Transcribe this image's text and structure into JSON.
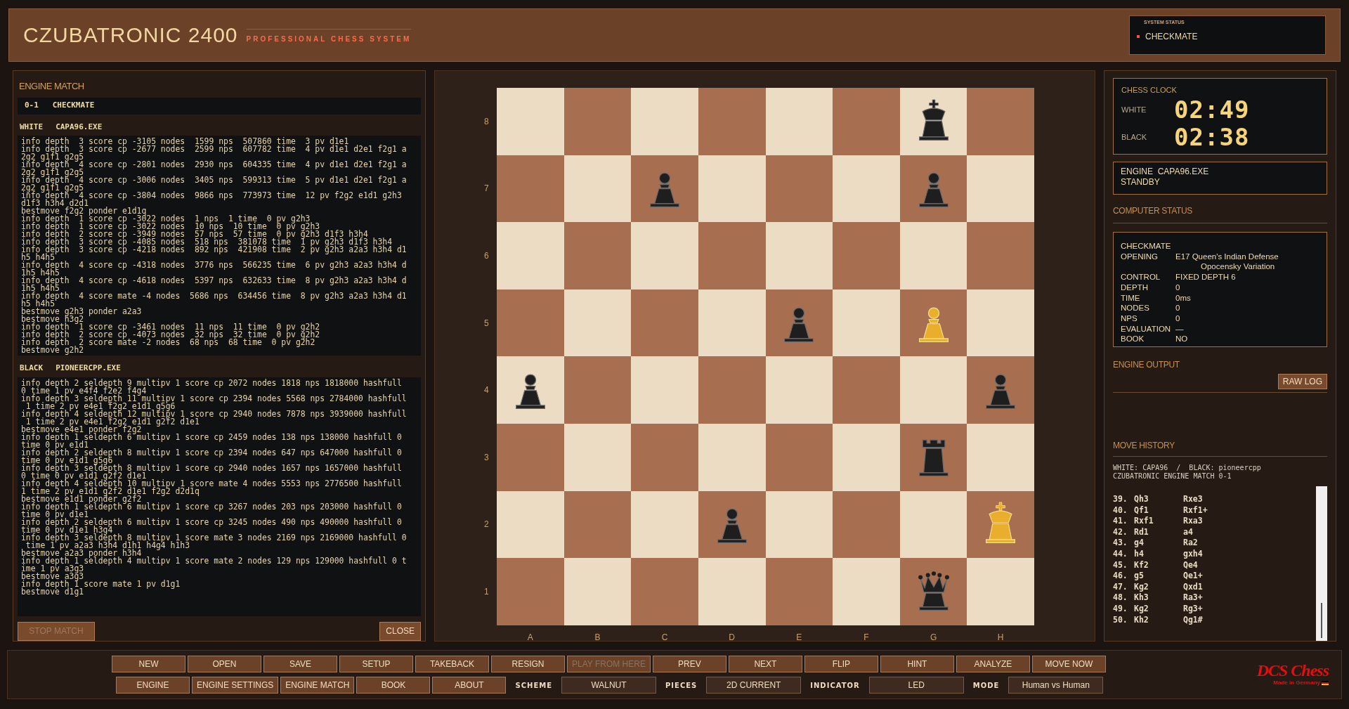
{
  "header": {
    "title": "CZUBATRONIC 2400",
    "subtitle": "PROFESSIONAL CHESS SYSTEM",
    "status_label": "SYSTEM STATUS",
    "status": "CHECKMATE"
  },
  "engine_match": {
    "title": "ENGINE MATCH",
    "result": "0-1   CHECKMATE",
    "white": {
      "label": "WHITE",
      "engine": "CAPA96.EXE",
      "log": [
        "info depth  3 score cp -3105 nodes  1599 nps  507860 time  3 pv d1e1",
        "info depth  3 score cp -2677 nodes  2599 nps  607782 time  4 pv d1e1 d2e1 f2g1 a",
        "2g2 g1f1 g2g5",
        "info depth  4 score cp -2801 nodes  2930 nps  604335 time  4 pv d1e1 d2e1 f2g1 a",
        "2g2 g1f1 g2g5",
        "info depth  4 score cp -3006 nodes  3405 nps  599313 time  5 pv d1e1 d2e1 f2g1 a",
        "2g2 g1f1 g2g5",
        "info depth  4 score cp -3804 nodes  9866 nps  773973 time  12 pv f2g2 e1d1 g2h3",
        "d1f3 h3h4 d2d1",
        "bestmove f2g2 ponder e1d1q",
        "info depth  1 score cp -3022 nodes  1 nps  1 time  0 pv g2h3",
        "info depth  1 score cp -3022 nodes  10 nps  10 time  0 pv g2h3",
        "info depth  2 score cp -3949 nodes  57 nps  57 time  0 pv g2h3 d1f3 h3h4",
        "info depth  3 score cp -4085 nodes  518 nps  381078 time  1 pv g2h3 d1f3 h3h4",
        "info depth  3 score cp -4218 nodes  892 nps  421908 time  2 pv g2h3 a2a3 h3h4 d1",
        "h5 h4h5",
        "info depth  4 score cp -4318 nodes  3776 nps  566235 time  6 pv g2h3 a2a3 h3h4 d",
        "1h5 h4h5",
        "info depth  4 score cp -4618 nodes  5397 nps  632633 time  8 pv g2h3 a2a3 h3h4 d",
        "1h5 h4h5",
        "info depth  4 score mate -4 nodes  5686 nps  634456 time  8 pv g2h3 a2a3 h3h4 d1",
        "h5 h4h5",
        "bestmove g2h3 ponder a2a3",
        "bestmove h3g2",
        "info depth  1 score cp -3461 nodes  11 nps  11 time  0 pv g2h2",
        "info depth  2 score cp -4073 nodes  32 nps  32 time  0 pv g2h2",
        "info depth  2 score mate -2 nodes  68 nps  68 time  0 pv g2h2",
        "bestmove g2h2"
      ]
    },
    "black": {
      "label": "BLACK",
      "engine": "PIONEERCPP.EXE",
      "log": [
        "info depth 2 seldepth 9 multipv 1 score cp 2072 nodes 1818 nps 1818000 hashfull",
        "0 time 1 pv e4f4 f2e2 f4g4",
        "info depth 3 seldepth 11 multipv 1 score cp 2394 nodes 5568 nps 2784000 hashfull",
        " 1 time 2 pv e4e1 f2g2 e1d1 g5g6",
        "info depth 4 seldepth 12 multipv 1 score cp 2940 nodes 7878 nps 3939000 hashfull",
        " 1 time 2 pv e4e1 f2g2 e1d1 g2f2 d1e1",
        "bestmove e4e1 ponder f2g2",
        "info depth 1 seldepth 6 multipv 1 score cp 2459 nodes 138 nps 138000 hashfull 0",
        "time 0 pv e1d1",
        "info depth 2 seldepth 8 multipv 1 score cp 2394 nodes 647 nps 647000 hashfull 0",
        "time 0 pv e1d1 g5g6",
        "info depth 3 seldepth 8 multipv 1 score cp 2940 nodes 1657 nps 1657000 hashfull",
        "0 time 0 pv e1d1 g2f2 d1e1",
        "info depth 4 seldepth 10 multipv 1 score mate 4 nodes 5553 nps 2776500 hashfull",
        "1 time 2 pv e1d1 g2f2 d1e1 f2g2 d2d1q",
        "bestmove e1d1 ponder g2f2",
        "info depth 1 seldepth 6 multipv 1 score cp 3267 nodes 203 nps 203000 hashfull 0",
        "time 0 pv d1e1",
        "info depth 2 seldepth 6 multipv 1 score cp 3245 nodes 490 nps 490000 hashfull 0",
        "time 0 pv d1e1 h3g4",
        "info depth 3 seldepth 8 multipv 1 score mate 3 nodes 2169 nps 2169000 hashfull 0",
        " time 1 pv a2a3 h3h4 d1h1 h4g4 h1h3",
        "bestmove a2a3 ponder h3h4",
        "info depth 1 seldepth 4 multipv 1 score mate 2 nodes 129 nps 129000 hashfull 0 t",
        "ime 1 pv a3g3",
        "bestmove a3g3",
        "info depth 1 score mate 1 pv d1g1",
        "bestmove d1g1"
      ]
    },
    "buttons": [
      {
        "label": "STOP MATCH",
        "disabled": true
      },
      {
        "label": "CLOSE",
        "disabled": false
      }
    ]
  },
  "board": {
    "files": [
      "A",
      "B",
      "C",
      "D",
      "E",
      "F",
      "G",
      "H"
    ],
    "rows": [
      {
        "rank": "8",
        "cells": [
          {
            "kind": "empty"
          },
          {
            "kind": "empty"
          },
          {
            "kind": "empty"
          },
          {
            "kind": "empty"
          },
          {
            "kind": "empty"
          },
          {
            "kind": "empty"
          },
          {
            "kind": "king",
            "white": false
          },
          {
            "kind": "empty"
          }
        ]
      },
      {
        "rank": "7",
        "cells": [
          {
            "kind": "empty"
          },
          {
            "kind": "empty"
          },
          {
            "kind": "pawn",
            "white": false
          },
          {
            "kind": "empty"
          },
          {
            "kind": "empty"
          },
          {
            "kind": "empty"
          },
          {
            "kind": "pawn",
            "white": false
          },
          {
            "kind": "empty"
          }
        ]
      },
      {
        "rank": "6",
        "cells": [
          {
            "kind": "empty"
          },
          {
            "kind": "empty"
          },
          {
            "kind": "empty"
          },
          {
            "kind": "empty"
          },
          {
            "kind": "empty"
          },
          {
            "kind": "empty"
          },
          {
            "kind": "empty"
          },
          {
            "kind": "empty"
          }
        ]
      },
      {
        "rank": "5",
        "cells": [
          {
            "kind": "empty"
          },
          {
            "kind": "empty"
          },
          {
            "kind": "empty"
          },
          {
            "kind": "empty"
          },
          {
            "kind": "pawn",
            "white": false
          },
          {
            "kind": "empty"
          },
          {
            "kind": "pawn",
            "white": true
          },
          {
            "kind": "empty"
          }
        ]
      },
      {
        "rank": "4",
        "cells": [
          {
            "kind": "pawn",
            "white": false
          },
          {
            "kind": "empty"
          },
          {
            "kind": "empty"
          },
          {
            "kind": "empty"
          },
          {
            "kind": "empty"
          },
          {
            "kind": "empty"
          },
          {
            "kind": "empty"
          },
          {
            "kind": "pawn",
            "white": false
          }
        ]
      },
      {
        "rank": "3",
        "cells": [
          {
            "kind": "empty"
          },
          {
            "kind": "empty"
          },
          {
            "kind": "empty"
          },
          {
            "kind": "empty"
          },
          {
            "kind": "empty"
          },
          {
            "kind": "empty"
          },
          {
            "kind": "rook",
            "white": false
          },
          {
            "kind": "empty"
          }
        ]
      },
      {
        "rank": "2",
        "cells": [
          {
            "kind": "empty"
          },
          {
            "kind": "empty"
          },
          {
            "kind": "empty"
          },
          {
            "kind": "pawn",
            "white": false
          },
          {
            "kind": "empty"
          },
          {
            "kind": "empty"
          },
          {
            "kind": "empty"
          },
          {
            "kind": "king",
            "white": true
          }
        ]
      },
      {
        "rank": "1",
        "cells": [
          {
            "kind": "empty"
          },
          {
            "kind": "empty"
          },
          {
            "kind": "empty"
          },
          {
            "kind": "empty"
          },
          {
            "kind": "empty"
          },
          {
            "kind": "empty"
          },
          {
            "kind": "queen",
            "white": false
          },
          {
            "kind": "empty"
          }
        ]
      }
    ]
  },
  "clock": {
    "title": "CHESS CLOCK",
    "white_label": "WHITE",
    "white_time": "02:49",
    "black_label": "BLACK",
    "black_time": "02:38"
  },
  "engine_status": [
    "ENGINE  CAPA96.EXE",
    "STANDBY"
  ],
  "computer_status": {
    "title": "COMPUTER STATUS",
    "headline": "CHECKMATE",
    "rows": [
      {
        "label": "OPENING",
        "value": [
          "E17 Queen's Indian Defense",
          "Opocensky Variation"
        ]
      },
      {
        "label": "CONTROL",
        "value": [
          "FIXED DEPTH 6"
        ]
      },
      {
        "label": "DEPTH",
        "value": [
          "0"
        ]
      },
      {
        "label": "TIME",
        "value": [
          "0ms"
        ]
      },
      {
        "label": "NODES",
        "value": [
          "0"
        ]
      },
      {
        "label": "NPS",
        "value": [
          "0"
        ]
      },
      {
        "label": "EVALUATION",
        "value": [
          "—"
        ]
      },
      {
        "label": "BOOK",
        "value": [
          "NO"
        ]
      }
    ]
  },
  "engine_output": {
    "title": "ENGINE OUTPUT",
    "button": "RAW LOG"
  },
  "move_history": {
    "title": "MOVE HISTORY",
    "players": "WHITE: CAPA96  /  BLACK: pioneercpp",
    "match": "CZUBATRONIC ENGINE MATCH 0-1",
    "moves": [
      {
        "number": "39.",
        "white": "Qh3",
        "black": "Rxe3"
      },
      {
        "number": "40.",
        "white": "Qf1",
        "black": "Rxf1+"
      },
      {
        "number": "41.",
        "white": "Rxf1",
        "black": "Rxa3"
      },
      {
        "number": "42.",
        "white": "Rd1",
        "black": "a4"
      },
      {
        "number": "43.",
        "white": "g4",
        "black": "Ra2"
      },
      {
        "number": "44.",
        "white": "h4",
        "black": "gxh4"
      },
      {
        "number": "45.",
        "white": "Kf2",
        "black": "Qe4"
      },
      {
        "number": "46.",
        "white": "g5",
        "black": "Qe1+"
      },
      {
        "number": "47.",
        "white": "Kg2",
        "black": "Qxd1"
      },
      {
        "number": "48.",
        "white": "Kh3",
        "black": "Ra3+"
      },
      {
        "number": "49.",
        "white": "Kg2",
        "black": "Rg3+"
      },
      {
        "number": "50.",
        "white": "Kh2",
        "black": "Qg1#"
      }
    ]
  },
  "toolbar": [
    [
      {
        "kind": "button",
        "label": "NEW",
        "disabled": false
      },
      {
        "kind": "button",
        "label": "OPEN",
        "disabled": false
      },
      {
        "kind": "button",
        "label": "SAVE",
        "disabled": false
      },
      {
        "kind": "button",
        "label": "SETUP",
        "disabled": false
      },
      {
        "kind": "button",
        "label": "TAKEBACK",
        "disabled": false
      },
      {
        "kind": "button",
        "label": "RESIGN",
        "disabled": false
      },
      {
        "kind": "button",
        "label": "PLAY FROM HERE",
        "disabled": true
      },
      {
        "kind": "button",
        "label": "PREV",
        "disabled": false
      },
      {
        "kind": "button",
        "label": "NEXT",
        "disabled": false
      },
      {
        "kind": "button",
        "label": "FLIP",
        "disabled": false
      },
      {
        "kind": "button",
        "label": "HINT",
        "disabled": false
      },
      {
        "kind": "button",
        "label": "ANALYZE",
        "disabled": false
      },
      {
        "kind": "button",
        "label": "MOVE NOW",
        "disabled": false
      }
    ],
    [
      {
        "kind": "button",
        "label": "ENGINE",
        "disabled": false
      },
      {
        "kind": "button",
        "label": "ENGINE SETTINGS",
        "disabled": false
      },
      {
        "kind": "button",
        "label": "ENGINE MATCH",
        "disabled": false
      },
      {
        "kind": "button",
        "label": "BOOK",
        "disabled": false
      },
      {
        "kind": "button",
        "label": "ABOUT",
        "disabled": false
      },
      {
        "kind": "label",
        "label": "SCHEME"
      },
      {
        "kind": "select",
        "label": "WALNUT"
      },
      {
        "kind": "label",
        "label": "PIECES"
      },
      {
        "kind": "select",
        "label": "2D CURRENT"
      },
      {
        "kind": "label",
        "label": "INDICATOR"
      },
      {
        "kind": "select",
        "label": "LED"
      },
      {
        "kind": "label",
        "label": "MODE"
      },
      {
        "kind": "select",
        "label": "Human vs Human"
      }
    ]
  ],
  "logo": {
    "name": "DCS Chess",
    "tagline": "Made in Germany"
  }
}
